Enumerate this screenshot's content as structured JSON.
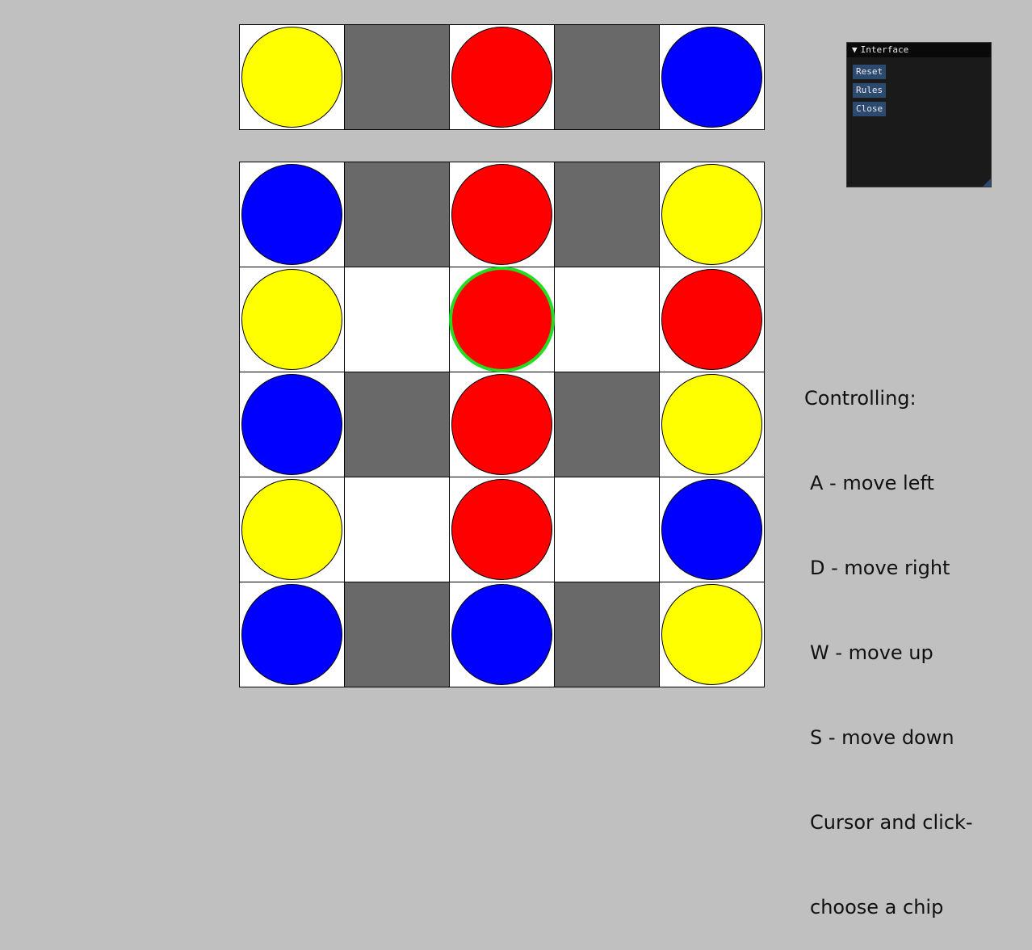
{
  "colors": {
    "yellow": "#ffff00",
    "red": "#ff0000",
    "blue": "#0000ff",
    "blocked": "#696969",
    "empty": "#ffffff",
    "selection": "#22dd22"
  },
  "target_row": [
    "yellow",
    "blocked",
    "red",
    "blocked",
    "blue"
  ],
  "board": [
    [
      "blue",
      "blocked",
      "red",
      "blocked",
      "yellow"
    ],
    [
      "yellow",
      "empty",
      "red",
      "empty",
      "red"
    ],
    [
      "blue",
      "blocked",
      "red",
      "blocked",
      "yellow"
    ],
    [
      "yellow",
      "empty",
      "red",
      "empty",
      "blue"
    ],
    [
      "blue",
      "blocked",
      "blue",
      "blocked",
      "yellow"
    ]
  ],
  "selected_cell": {
    "row": 1,
    "col": 2
  },
  "interface_panel": {
    "arrow": "▼",
    "title": "Interface",
    "reset_label": "Reset",
    "rules_label": "Rules",
    "close_label": "Close"
  },
  "controls": {
    "heading": "Controlling:",
    "lines": [
      "A - move left",
      "D - move right",
      "W - move up",
      "S - move down",
      "Cursor and click-",
      "choose a chip"
    ]
  }
}
